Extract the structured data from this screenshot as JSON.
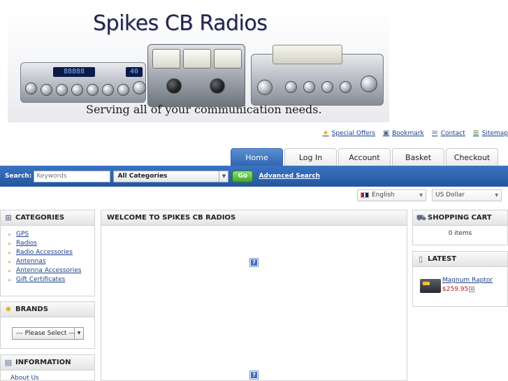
{
  "banner": {
    "title": "Spikes CB Radios",
    "tagline": "Serving all of your communication needs.",
    "lcd_left": "88888",
    "lcd_channel": "40"
  },
  "toplinks": [
    {
      "label": "Special Offers",
      "icon": "star-icon"
    },
    {
      "label": "Bookmark",
      "icon": "bookmark-icon"
    },
    {
      "label": "Contact",
      "icon": "mail-icon"
    },
    {
      "label": "Sitemap",
      "icon": "sitemap-icon"
    }
  ],
  "tabs": [
    {
      "label": "Home",
      "active": true
    },
    {
      "label": "Log In",
      "active": false
    },
    {
      "label": "Account",
      "active": false
    },
    {
      "label": "Basket",
      "active": false
    },
    {
      "label": "Checkout",
      "active": false
    }
  ],
  "search": {
    "label": "Search:",
    "placeholder": "Keywords",
    "category": "All Categories",
    "go_label": "Go",
    "advanced_label": "Advanced Search"
  },
  "language": {
    "selected": "English"
  },
  "currency": {
    "selected": "US Dollar"
  },
  "categories": {
    "title": "CATEGORIES",
    "items": [
      "GPS",
      "Radios",
      "Radio Accessories",
      "Antennas",
      "Antenna Accessories",
      "Gift Certificates"
    ]
  },
  "brands": {
    "title": "BRANDS",
    "select": "--- Please Select ---"
  },
  "information": {
    "title": "INFORMATION",
    "peek": "About Us"
  },
  "welcome": {
    "title": "WELCOME TO SPIKES CB RADIOS"
  },
  "cart": {
    "title": "SHOPPING CART",
    "items": "0 items"
  },
  "latest": {
    "title": "LATEST",
    "product_name": "Magnum Raptor",
    "product_price": "$259.95"
  },
  "colors": {
    "nav_blue": "#2f66b2",
    "link": "#1c3f8c",
    "price": "#c0161a",
    "go_green": "#3fa529"
  }
}
